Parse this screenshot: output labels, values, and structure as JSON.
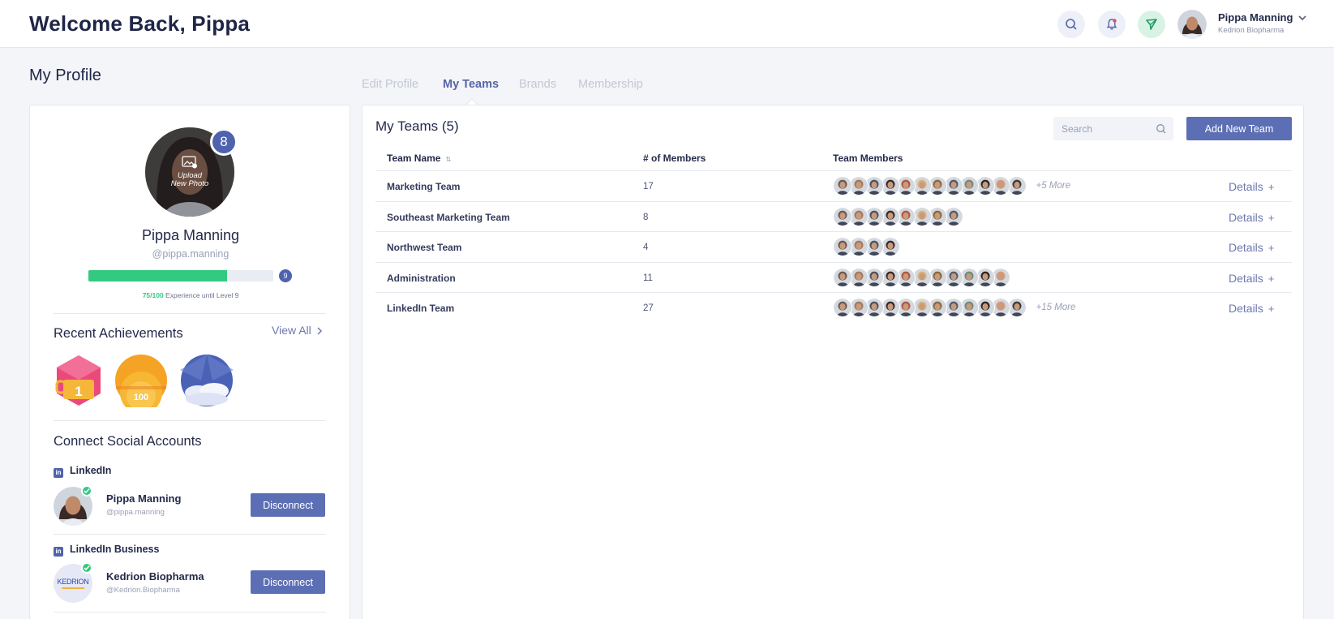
{
  "header": {
    "welcome": "Welcome Back, Pippa",
    "user_name": "Pippa Manning",
    "user_company": "Kedrion Biopharma"
  },
  "page_title": "My Profile",
  "tabs": [
    {
      "label": "Edit Profile",
      "active": false
    },
    {
      "label": "My Teams",
      "active": true
    },
    {
      "label": "Brands",
      "active": false
    },
    {
      "label": "Membership",
      "active": false
    }
  ],
  "profile": {
    "upload_line1": "Upload",
    "upload_line2": "New Photo",
    "level": "8",
    "name": "Pippa Manning",
    "handle": "@pippa.manning",
    "xp_current": 75,
    "xp_max": 100,
    "xp_value_text": "75/100",
    "xp_suffix": " Experience until Level 9",
    "next_level": "9"
  },
  "achievements": {
    "title": "Recent Achievements",
    "view_all": "View All",
    "badges": [
      {
        "icon": "gold-trophy-hexagon-icon",
        "text": "1"
      },
      {
        "icon": "orange-sun-100-icon",
        "text": "100"
      },
      {
        "icon": "cloud-sky-badge-icon",
        "text": ""
      }
    ]
  },
  "social": {
    "title": "Connect Social Accounts",
    "accounts": [
      {
        "platform": "LinkedIn",
        "name": "Pippa Manning",
        "handle": "@pippa.manning",
        "button": "Disconnect",
        "avatar_text": ""
      },
      {
        "platform": "LinkedIn Business",
        "name": "Kedrion Biopharma",
        "handle": "@Kedrion.Biopharma",
        "button": "Disconnect",
        "avatar_text": "KEDRION"
      }
    ]
  },
  "teams": {
    "title": "My Teams (5)",
    "search_placeholder": "Search",
    "add_button": "Add New Team",
    "columns": [
      "Team Name",
      "# of Members",
      "Team Members"
    ],
    "details_label": "Details",
    "details_plus": "+",
    "rows": [
      {
        "name": "Marketing Team",
        "count": "17",
        "shown": 12,
        "more": "+5 More"
      },
      {
        "name": "Southeast Marketing Team",
        "count": "8",
        "shown": 8,
        "more": ""
      },
      {
        "name": "Northwest Team",
        "count": "4",
        "shown": 4,
        "more": ""
      },
      {
        "name": "Administration",
        "count": "11",
        "shown": 11,
        "more": ""
      },
      {
        "name": "LinkedIn Team",
        "count": "27",
        "shown": 12,
        "more": "+15 More"
      }
    ]
  },
  "colors": {
    "accent": "#5d6fb4",
    "success": "#33c981",
    "avatar_palette": [
      "#6b5a52",
      "#a07a5e",
      "#4d5360",
      "#3b2a28",
      "#b0583e",
      "#d9b07a",
      "#8a6a3a",
      "#545c68",
      "#6f8a7a",
      "#2e2624",
      "#d69a7a",
      "#3d3a3a"
    ]
  }
}
